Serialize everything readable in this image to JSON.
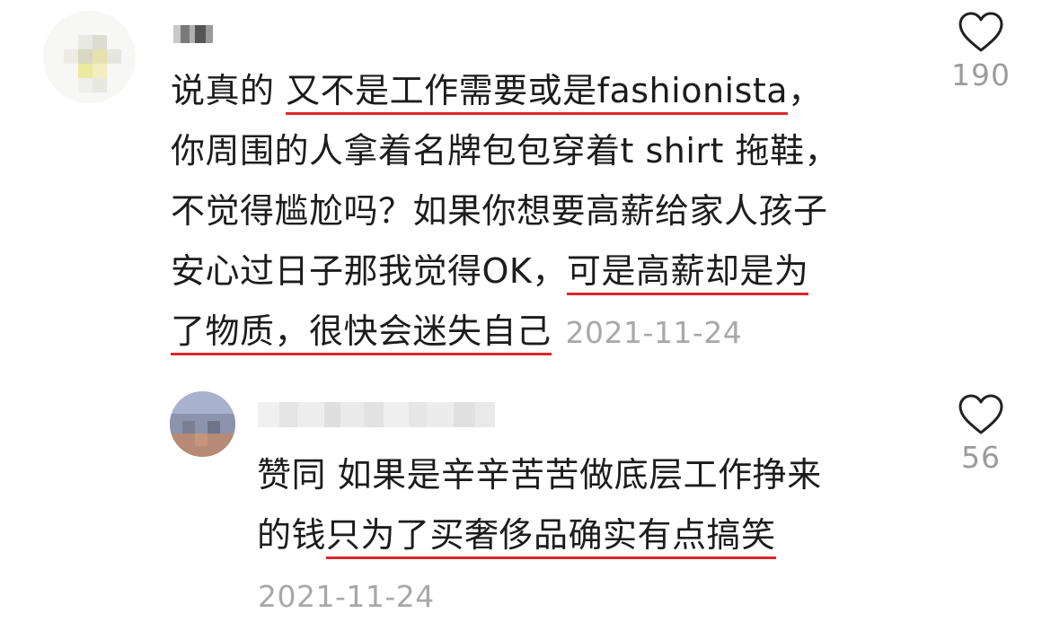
{
  "comment": {
    "text_segments_line1": [
      "说真的 ",
      "又不是工作需要或是fashionista",
      "，"
    ],
    "line2": "你周围的人拿着名牌包包穿着t shirt 拖鞋，",
    "line3": "不觉得尴尬吗？如果你想要高薪给家人孩子",
    "text_segments_line4": [
      "安心过日子那我觉得OK，",
      "可是高薪却是为"
    ],
    "text_segments_line5": [
      "了物质，很快会迷失自己"
    ],
    "date": "2021-11-24",
    "likes": "190",
    "like_icon": "heart-outline-icon"
  },
  "reply": {
    "line1": "赞同 如果是辛辛苦苦做底层工作挣来",
    "text_segments_line2": [
      "的钱",
      "只为了买奢侈品确实有点搞笑"
    ],
    "date": "2021-11-24",
    "likes": "56",
    "like_icon": "heart-outline-icon"
  },
  "colors": {
    "underline": "#e0242b",
    "meta_text": "#a8a8a8",
    "body_text": "#1c1c1c"
  }
}
